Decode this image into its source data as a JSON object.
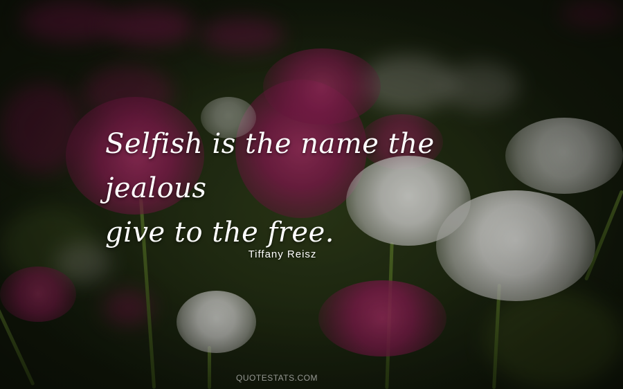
{
  "quote": {
    "line1": "Selfish is the name the jealous",
    "line2": "give to the free."
  },
  "author": "Tiffany Reisz",
  "watermark": "QUOTESTATS.COM",
  "colors": {
    "text": "#ffffff",
    "flower_pink": "#8a1f52",
    "flower_white": "#e8e8e4",
    "foliage": "#2a3318"
  }
}
